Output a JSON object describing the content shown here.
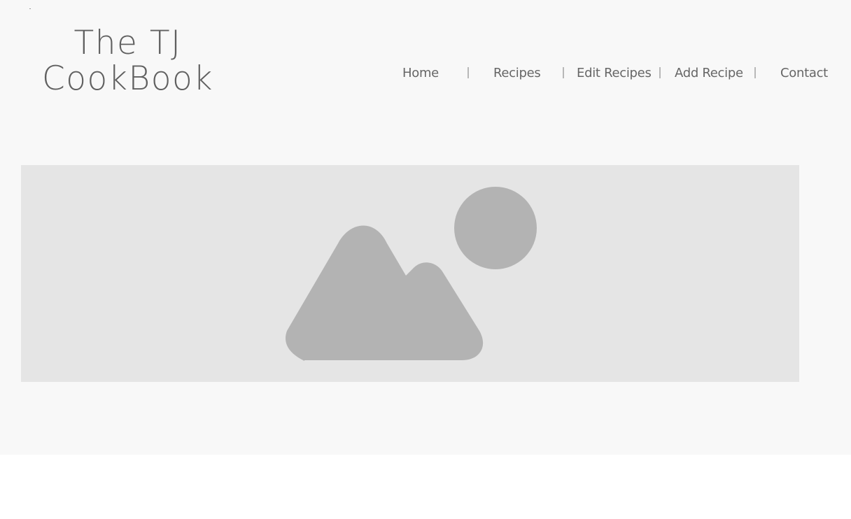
{
  "site": {
    "title_line1": "The TJ",
    "title_line2": "CookBook"
  },
  "nav": {
    "items": [
      {
        "label": "Home"
      },
      {
        "label": "Recipes"
      },
      {
        "label": "Edit Recipes"
      },
      {
        "label": "Add Recipe"
      },
      {
        "label": "Contact"
      }
    ]
  },
  "hero": {
    "icon": "image-placeholder-icon"
  },
  "colors": {
    "page_bg": "#f8f8f8",
    "placeholder_bg": "#e5e5e5",
    "placeholder_shape": "#b3b3b3",
    "text": "#606060"
  }
}
